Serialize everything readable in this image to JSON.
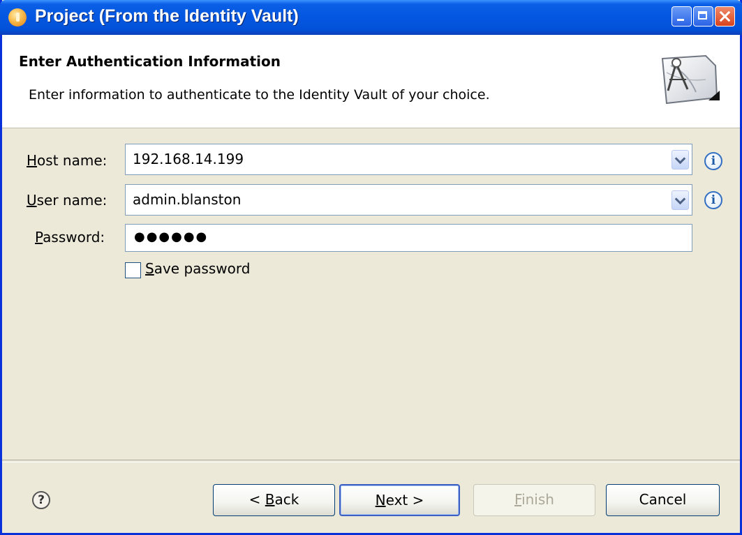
{
  "window": {
    "title": "Project (From the Identity Vault)"
  },
  "header": {
    "title": "Enter Authentication Information",
    "description": "Enter information to authenticate to the Identity Vault of your choice."
  },
  "form": {
    "host_label_mnemonic": "H",
    "host_label_rest": "ost name:",
    "host_value": "192.168.14.199",
    "user_label_mnemonic": "U",
    "user_label_rest": "ser name:",
    "user_value": "admin.blanston",
    "password_label_mnemonic": "P",
    "password_label_rest": "assword:",
    "password_value": "●●●●●●",
    "save_password_mnemonic": "S",
    "save_password_rest": "ave password",
    "save_password_checked": false
  },
  "buttons": {
    "back_prefix": "< ",
    "back_mnemonic": "B",
    "back_rest": "ack",
    "next_mnemonic": "N",
    "next_rest": "ext >",
    "finish_mnemonic": "F",
    "finish_rest": "inish",
    "cancel": "Cancel"
  },
  "icons": {
    "info": "i",
    "help": "?"
  },
  "colors": {
    "titlebar": "#0457e0",
    "dialog_bg": "#ece9d8",
    "header_bg": "#ffffff",
    "input_border": "#7f9db9",
    "disabled_text": "#aca899"
  }
}
